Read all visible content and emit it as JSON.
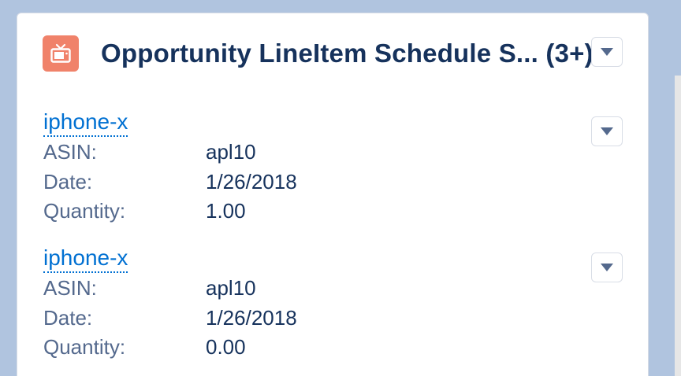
{
  "card": {
    "title": "Opportunity LineItem Schedule S... (3+)",
    "icon": "tv-icon",
    "accent_color": "#f0826a",
    "link_color": "#0070d2"
  },
  "records": [
    {
      "name": "iphone-x",
      "fields": [
        {
          "label": "ASIN:",
          "value": "apl10"
        },
        {
          "label": "Date:",
          "value": "1/26/2018"
        },
        {
          "label": "Quantity:",
          "value": "1.00"
        }
      ]
    },
    {
      "name": "iphone-x",
      "fields": [
        {
          "label": "ASIN:",
          "value": "apl10"
        },
        {
          "label": "Date:",
          "value": "1/26/2018"
        },
        {
          "label": "Quantity:",
          "value": "0.00"
        }
      ]
    }
  ]
}
